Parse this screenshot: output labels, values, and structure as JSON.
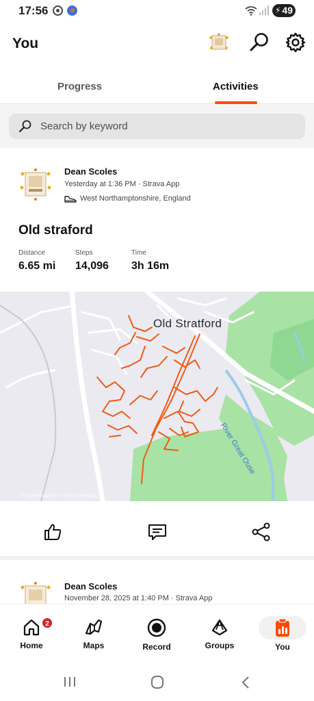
{
  "status_bar": {
    "time": "17:56",
    "battery": "49"
  },
  "header": {
    "title": "You"
  },
  "tabs": [
    {
      "label": "Progress",
      "active": false
    },
    {
      "label": "Activities",
      "active": true
    }
  ],
  "search": {
    "placeholder": "Search by keyword"
  },
  "activity": {
    "athlete": "Dean Scoles",
    "meta": "Yesterday at 1:36 PM · Strava App",
    "location": "West Northamptonshire, England",
    "title": "Old straford",
    "stats": [
      {
        "label": "Distance",
        "value": "6.65 mi"
      },
      {
        "label": "Steps",
        "value": "14,096"
      },
      {
        "label": "Time",
        "value": "3h 16m"
      }
    ],
    "map": {
      "place_label": "Old Stratford",
      "river_label": "River Great Ouse",
      "attribution": "© OpenMapTiles © OpenStreetMap"
    }
  },
  "next_activity": {
    "athlete": "Dean Scoles",
    "meta": "November 28, 2025 at 1:40 PM · Strava App"
  },
  "bottom_nav": [
    {
      "label": "Home",
      "icon": "home-icon",
      "badge": "2"
    },
    {
      "label": "Maps",
      "icon": "maps-icon"
    },
    {
      "label": "Record",
      "icon": "record-icon"
    },
    {
      "label": "Groups",
      "icon": "groups-icon"
    },
    {
      "label": "You",
      "icon": "you-icon",
      "active": true
    }
  ],
  "colors": {
    "accent": "#fc4c02",
    "badge": "#d6232b",
    "route": "#f05a14",
    "park": "#a8e2a5",
    "water": "#9ccbe8"
  }
}
